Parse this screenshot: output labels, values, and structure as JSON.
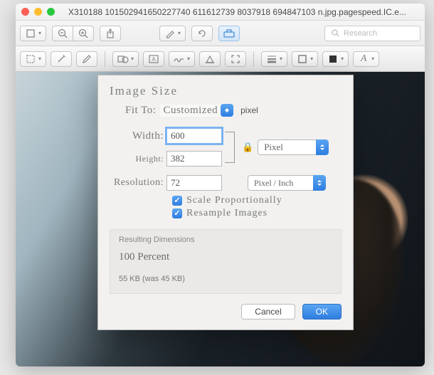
{
  "window": {
    "title": "X310188 101502941650227740 611612739 8037918 694847103 n.jpg.pagespeed.IC.e..."
  },
  "search": {
    "placeholder": "Research"
  },
  "dialog": {
    "title": "Image Size",
    "fit_to_label": "Fit To:",
    "fit_to_value": "Customized",
    "fit_unit": "pixel",
    "width_label": "Width:",
    "width_value": "600",
    "width_unit": "Pixel",
    "height_label": "Height:",
    "height_value": "382",
    "resolution_label": "Resolution:",
    "resolution_value": "72",
    "resolution_unit": "Pixel / Inch",
    "scale_label": "Scale Proportionally",
    "resample_label": "Resample Images",
    "result_title": "Resulting Dimensions",
    "result_percent": "100 Percent",
    "result_size": "55 KB (was 45 KB)",
    "cancel": "Cancel",
    "ok": "OK"
  }
}
